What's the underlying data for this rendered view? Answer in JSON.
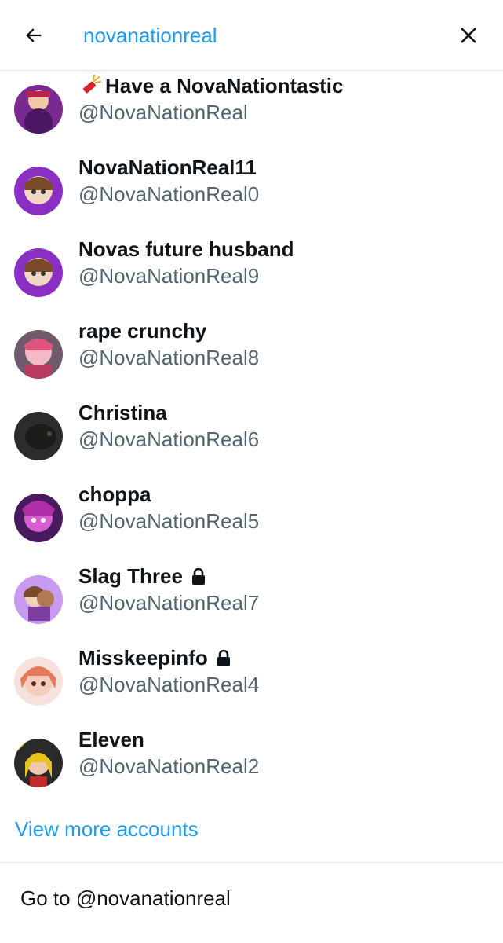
{
  "search": {
    "query": "novanationreal"
  },
  "results": [
    {
      "name": "Have a NovaNationtastic",
      "handle": "@NovaNationReal",
      "prefix_icon": "firecracker-icon",
      "locked": false
    },
    {
      "name": "NovaNationReal11",
      "handle": "@NovaNationReal0",
      "locked": false
    },
    {
      "name": "Novas future husband",
      "handle": "@NovaNationReal9",
      "locked": false
    },
    {
      "name": "rape crunchy",
      "handle": "@NovaNationReal8",
      "locked": false
    },
    {
      "name": "Christina",
      "handle": "@NovaNationReal6",
      "locked": false
    },
    {
      "name": "choppa",
      "handle": "@NovaNationReal5",
      "locked": false
    },
    {
      "name": "Slag Three",
      "handle": "@NovaNationReal7",
      "locked": true
    },
    {
      "name": "Misskeepinfo",
      "handle": "@NovaNationReal4",
      "locked": true
    },
    {
      "name": "Eleven",
      "handle": "@NovaNationReal2",
      "locked": false
    }
  ],
  "footer": {
    "view_more": "View more accounts",
    "goto": "Go to @novanationreal"
  },
  "colors": {
    "accent": "#1d9bf0",
    "text_primary": "#0f1419",
    "text_secondary": "#536471",
    "divider": "#e6e6e6"
  }
}
